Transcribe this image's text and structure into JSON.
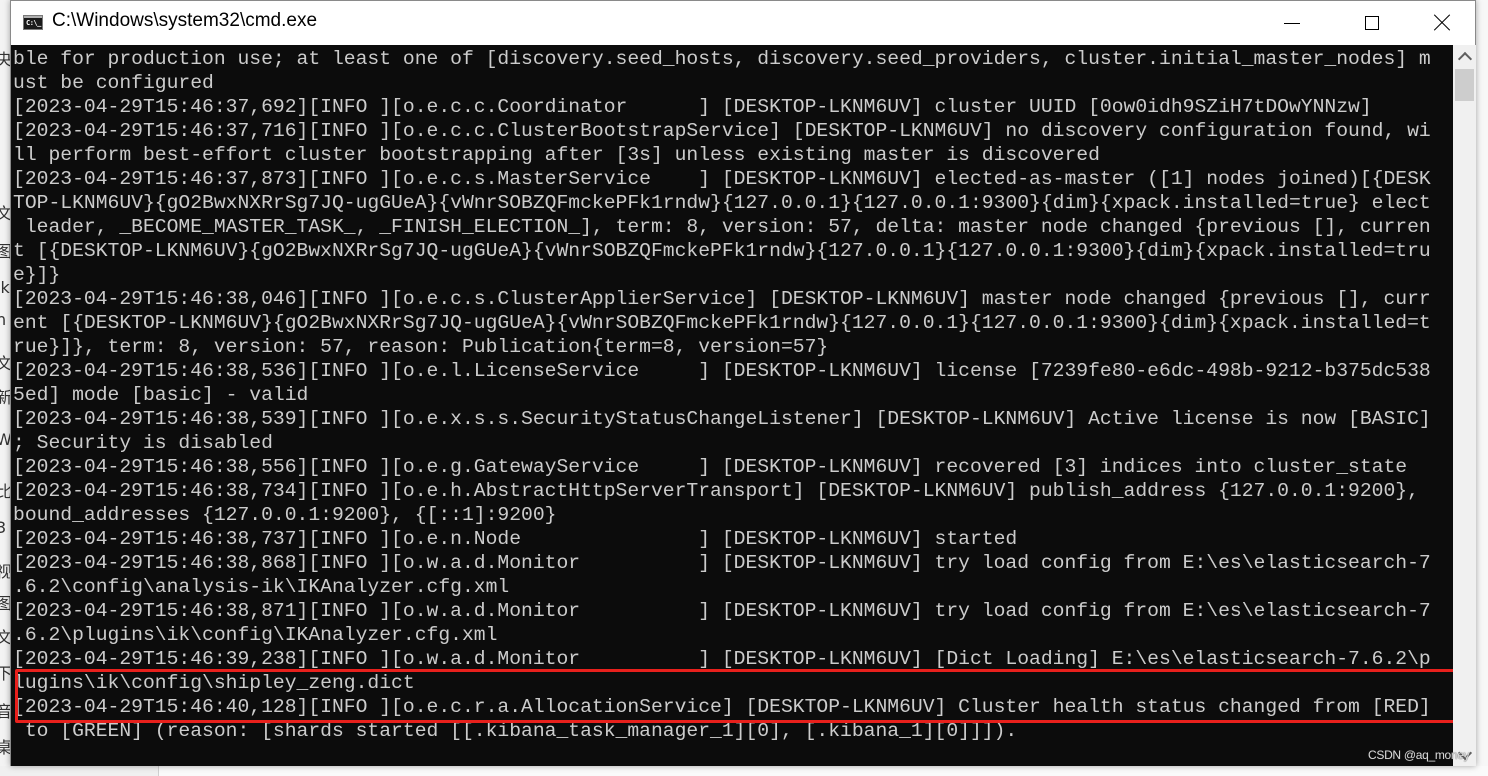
{
  "window": {
    "title": "C:\\Windows\\system32\\cmd.exe",
    "icon": "cmd-icon",
    "icon_text": "C:\\_",
    "controls": {
      "minimize": "minimize-icon",
      "maximize": "maximize-icon",
      "close": "close-icon"
    }
  },
  "console": {
    "background": "#0c0c0c",
    "foreground": "#cccccc",
    "lines": [
      "ble for production use; at least one of [discovery.seed_hosts, discovery.seed_providers, cluster.initial_master_nodes] m",
      "ust be configured",
      "[2023-04-29T15:46:37,692][INFO ][o.e.c.c.Coordinator      ] [DESKTOP-LKNM6UV] cluster UUID [0ow0idh9SZiH7tDOwYNNzw]",
      "[2023-04-29T15:46:37,716][INFO ][o.e.c.c.ClusterBootstrapService] [DESKTOP-LKNM6UV] no discovery configuration found, wi",
      "ll perform best-effort cluster bootstrapping after [3s] unless existing master is discovered",
      "[2023-04-29T15:46:37,873][INFO ][o.e.c.s.MasterService    ] [DESKTOP-LKNM6UV] elected-as-master ([1] nodes joined)[{DESK",
      "TOP-LKNM6UV}{gO2BwxNXRrSg7JQ-ugGUeA}{vWnrSOBZQFmckePFk1rndw}{127.0.0.1}{127.0.0.1:9300}{dim}{xpack.installed=true} elect",
      " leader, _BECOME_MASTER_TASK_, _FINISH_ELECTION_], term: 8, version: 57, delta: master node changed {previous [], curren",
      "t [{DESKTOP-LKNM6UV}{gO2BwxNXRrSg7JQ-ugGUeA}{vWnrSOBZQFmckePFk1rndw}{127.0.0.1}{127.0.0.1:9300}{dim}{xpack.installed=tru",
      "e}]}",
      "[2023-04-29T15:46:38,046][INFO ][o.e.c.s.ClusterApplierService] [DESKTOP-LKNM6UV] master node changed {previous [], curr",
      "ent [{DESKTOP-LKNM6UV}{gO2BwxNXRrSg7JQ-ugGUeA}{vWnrSOBZQFmckePFk1rndw}{127.0.0.1}{127.0.0.1:9300}{dim}{xpack.installed=t",
      "rue}]}, term: 8, version: 57, reason: Publication{term=8, version=57}",
      "[2023-04-29T15:46:38,536][INFO ][o.e.l.LicenseService     ] [DESKTOP-LKNM6UV] license [7239fe80-e6dc-498b-9212-b375dc538",
      "5ed] mode [basic] - valid",
      "[2023-04-29T15:46:38,539][INFO ][o.e.x.s.s.SecurityStatusChangeListener] [DESKTOP-LKNM6UV] Active license is now [BASIC]",
      "; Security is disabled",
      "[2023-04-29T15:46:38,556][INFO ][o.e.g.GatewayService     ] [DESKTOP-LKNM6UV] recovered [3] indices into cluster_state",
      "[2023-04-29T15:46:38,734][INFO ][o.e.h.AbstractHttpServerTransport] [DESKTOP-LKNM6UV] publish_address {127.0.0.1:9200},",
      "bound_addresses {127.0.0.1:9200}, {[::1]:9200}",
      "[2023-04-29T15:46:38,737][INFO ][o.e.n.Node               ] [DESKTOP-LKNM6UV] started",
      "[2023-04-29T15:46:38,868][INFO ][o.w.a.d.Monitor          ] [DESKTOP-LKNM6UV] try load config from E:\\es\\elasticsearch-7",
      ".6.2\\config\\analysis-ik\\IKAnalyzer.cfg.xml",
      "[2023-04-29T15:46:38,871][INFO ][o.w.a.d.Monitor          ] [DESKTOP-LKNM6UV] try load config from E:\\es\\elasticsearch-7",
      ".6.2\\plugins\\ik\\config\\IKAnalyzer.cfg.xml",
      "[2023-04-29T15:46:39,238][INFO ][o.w.a.d.Monitor          ] [DESKTOP-LKNM6UV] [Dict Loading] E:\\es\\elasticsearch-7.6.2\\p",
      "lugins\\ik\\config\\shipley_zeng.dict",
      "[2023-04-29T15:46:40,128][INFO ][o.e.c.r.a.AllocationService] [DESKTOP-LKNM6UV] Cluster health status changed from [RED]",
      " to [GREEN] (reason: [shards started [[.kibana_task_manager_1][0], [.kibana_1][0]]])."
    ],
    "highlighted_lines": [
      26,
      27
    ],
    "highlight_color": "#e8201c"
  },
  "scrollbar": {
    "up": "scroll-up-arrow-icon",
    "down": "scroll-down-arrow-icon"
  },
  "background": {
    "side_chars": [
      "央",
      "文",
      "图",
      "ik",
      "n",
      "文",
      "新",
      "Wi",
      "比",
      "3",
      "视",
      "图",
      "文",
      "下",
      "音",
      "桌"
    ]
  },
  "watermark": "CSDN @aq_money"
}
